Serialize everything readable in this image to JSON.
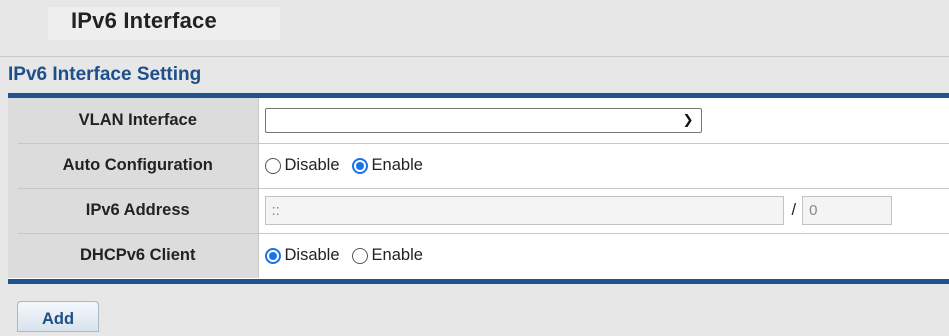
{
  "header": {
    "title": "IPv6 Interface"
  },
  "section": {
    "title": "IPv6 Interface Setting"
  },
  "form": {
    "vlan_interface": {
      "label": "VLAN Interface",
      "selected": ""
    },
    "auto_configuration": {
      "label": "Auto Configuration",
      "options": [
        "Disable",
        "Enable"
      ],
      "selected": "Enable"
    },
    "ipv6_address": {
      "label": "IPv6 Address",
      "address_value": "::",
      "separator": "/",
      "prefix_value": "0"
    },
    "dhcpv6_client": {
      "label": "DHCPv6 Client",
      "options": [
        "Disable",
        "Enable"
      ],
      "selected": "Disable"
    }
  },
  "buttons": {
    "add_label": "Add"
  },
  "colors": {
    "accent": "#1e5590",
    "radio": "#1a73e8",
    "label_bg": "#dcdcdc"
  }
}
